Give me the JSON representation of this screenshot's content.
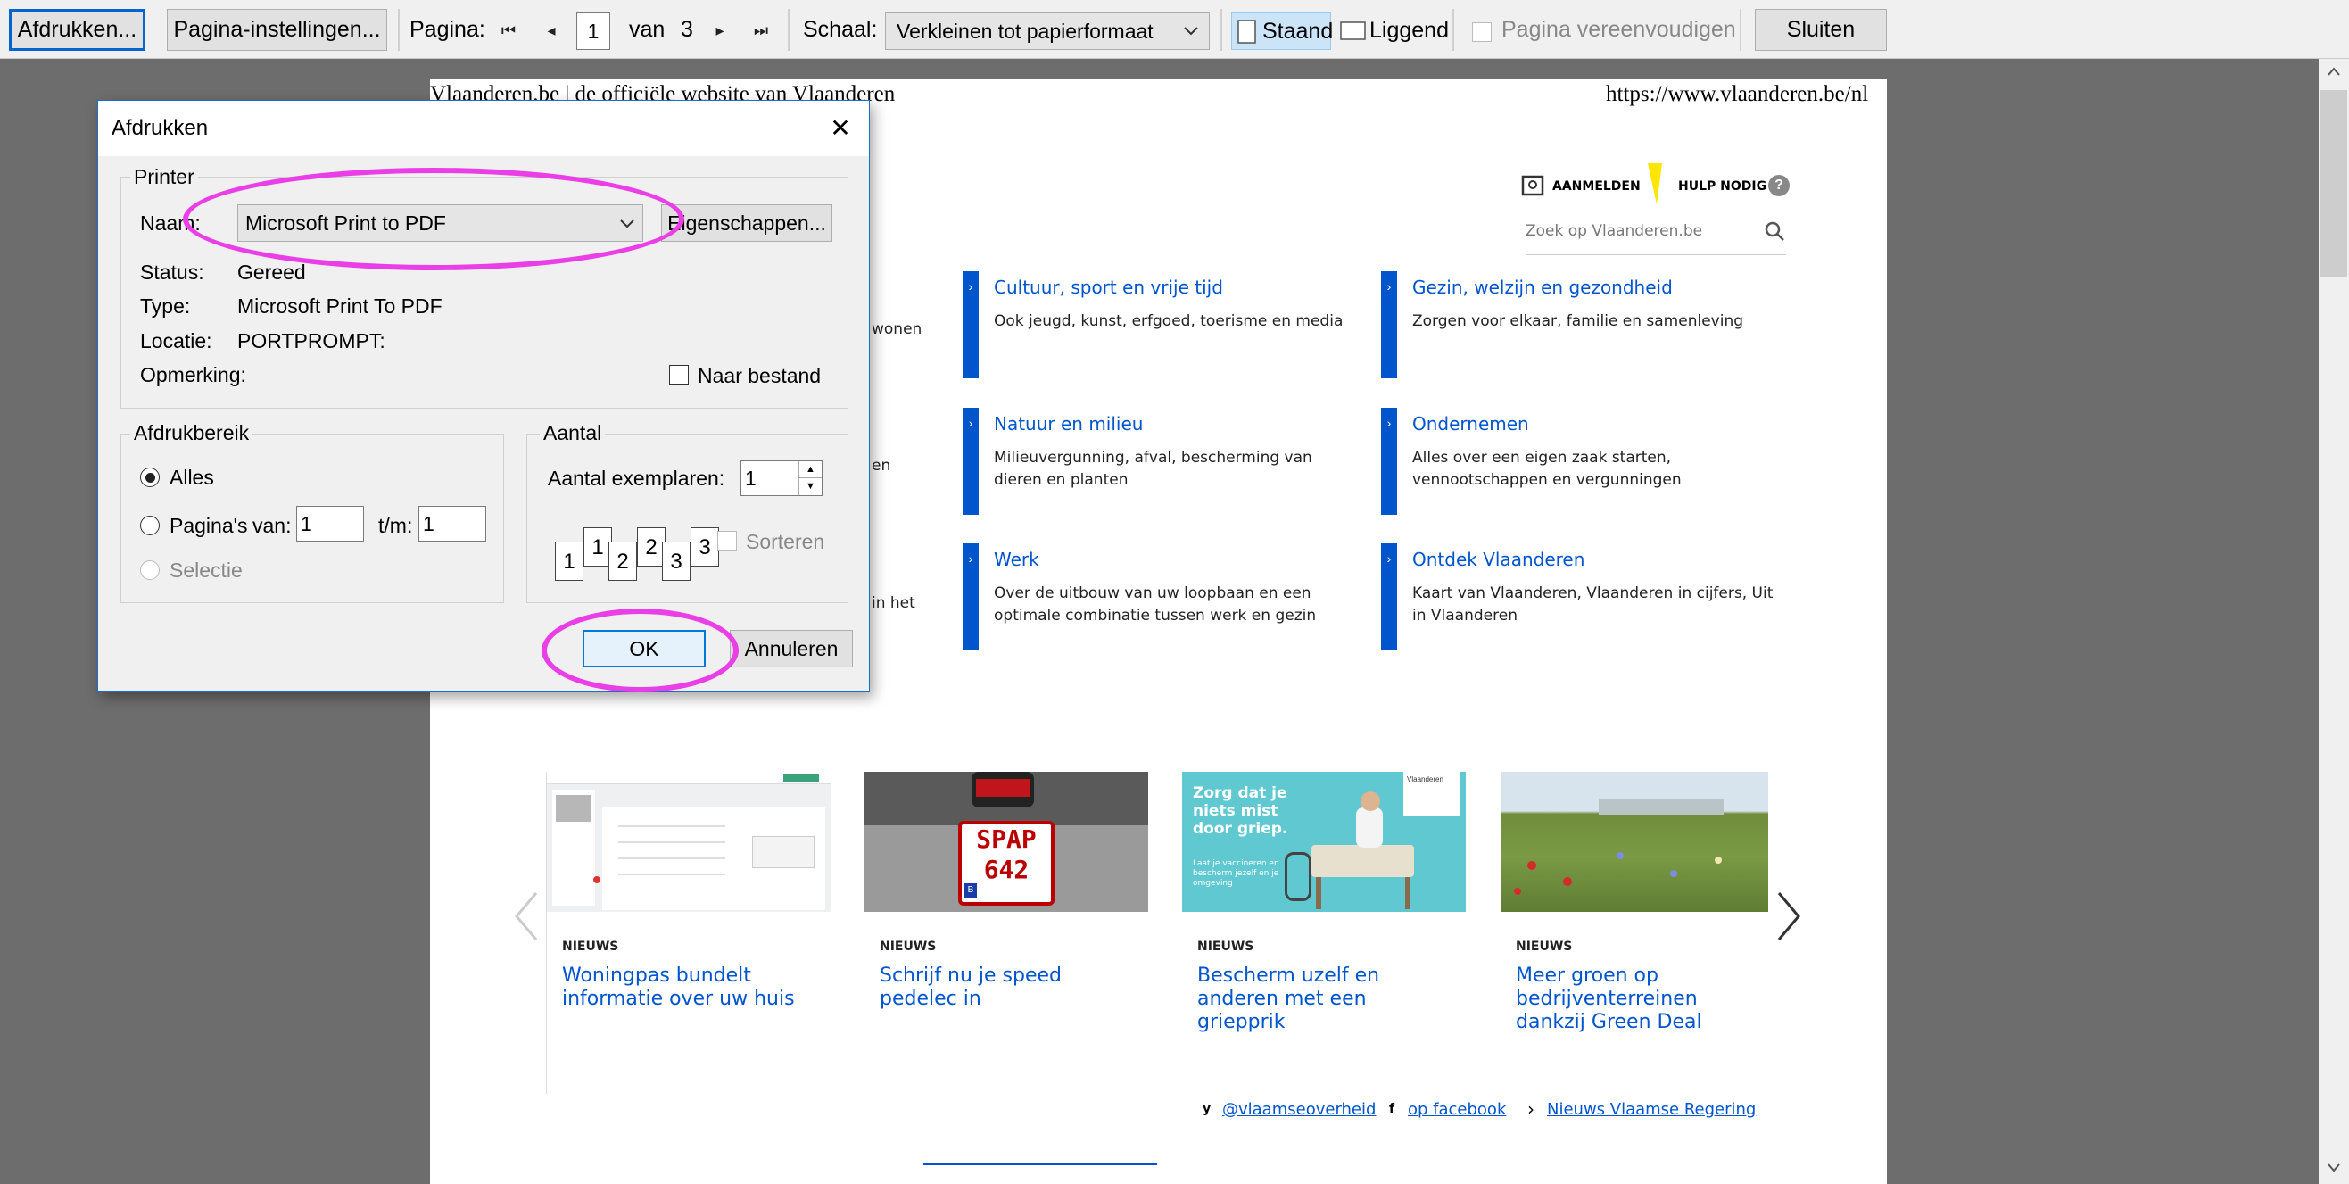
{
  "toolbar": {
    "print_label": "Afdrukken...",
    "page_setup_label": "Pagina-instellingen...",
    "page_label": "Pagina:",
    "first_label": "⏮",
    "prev_label": "◂",
    "current_page": "1",
    "of_label": "van",
    "total_pages": "3",
    "next_label": "▸",
    "last_label": "⏭",
    "scale_label": "Schaal:",
    "scale_value": "Verkleinen tot papierformaat",
    "portrait_label": "Staand",
    "landscape_label": "Liggend",
    "simplify_label": "Pagina vereenvoudigen",
    "close_label": "Sluiten"
  },
  "page": {
    "header_left": "Vlaanderen.be | de officiële website van Vlaanderen",
    "header_right": "https://www.vlaanderen.be/nl",
    "login_label": "AANMELDEN",
    "help_label": "HULP NODIG",
    "help_icon_text": "?",
    "search_placeholder": "Zoek op Vlaanderen.be",
    "left_fragments": [
      "wonen",
      "en",
      "in het"
    ],
    "categories": [
      {
        "title": "Cultuur, sport en vrije tijd",
        "desc": "Ook jeugd, kunst, erfgoed, toerisme en media"
      },
      {
        "title": "Gezin, welzijn en gezondheid",
        "desc": "Zorgen voor elkaar, familie en samenleving"
      },
      {
        "title": "Natuur en milieu",
        "desc": "Milieuvergunning, afval, bescherming van dieren en planten"
      },
      {
        "title": "Ondernemen",
        "desc": "Alles over een eigen zaak starten, vennootschappen en vergunningen"
      },
      {
        "title": "Werk",
        "desc": "Over de uitbouw van uw loopbaan en een optimale combinatie tussen werk en gezin"
      },
      {
        "title": "Ontdek Vlaanderen",
        "desc": "Kaart van Vlaanderen, Vlaanderen in cijfers, Uit in Vlaanderen"
      }
    ],
    "news": [
      {
        "tag": "NIEUWS",
        "title": "Woningpas bundelt informatie over uw huis"
      },
      {
        "tag": "NIEUWS",
        "title": "Schrijf nu je speed pedelec in"
      },
      {
        "tag": "NIEUWS",
        "title": "Bescherm uzelf en anderen met een griepprik"
      },
      {
        "tag": "NIEUWS",
        "title": "Meer groen op bedrijventerreinen dankzij Green Deal"
      }
    ],
    "plate_text_1": "SPAP",
    "plate_text_2": "642",
    "plate_flag": "B",
    "flu_text": "Zorg dat je niets mist door griep.",
    "flu_subtext": "Laat je vaccineren en bescherm jezelf en je omgeving",
    "flu_badge": "Vlaanderen",
    "social": [
      {
        "icon": "y",
        "label": "@vlaamseoverheid"
      },
      {
        "icon": "f",
        "label": "op facebook"
      },
      {
        "icon": "›",
        "label": "Nieuws Vlaamse Regering"
      }
    ]
  },
  "dialog": {
    "title": "Afdrukken",
    "close_label": "✕",
    "printer_group": "Printer",
    "name_label": "Naam:",
    "printer_name": "Microsoft Print to PDF",
    "properties_label": "Eigenschappen...",
    "status_label": "Status:",
    "status_value": "Gereed",
    "type_label": "Type:",
    "type_value": "Microsoft Print To PDF",
    "location_label": "Locatie:",
    "location_value": "PORTPROMPT:",
    "comment_label": "Opmerking:",
    "to_file_label": "Naar bestand",
    "range_group": "Afdrukbereik",
    "all_label": "Alles",
    "pages_label": "Pagina's",
    "from_label": "van:",
    "from_value": "1",
    "to_label": "t/m:",
    "to_value": "1",
    "selection_label": "Selectie",
    "copies_group": "Aantal",
    "copies_label": "Aantal exemplaren:",
    "copies_value": "1",
    "collate_label": "Sorteren",
    "collate_icons": [
      "1",
      "1",
      "2",
      "2",
      "3",
      "3"
    ],
    "ok_label": "OK",
    "cancel_label": "Annuleren"
  },
  "colors": {
    "accent": "#0055cc",
    "annotation": "#ea3ee7",
    "dialog_border": "#1c6fc7"
  }
}
